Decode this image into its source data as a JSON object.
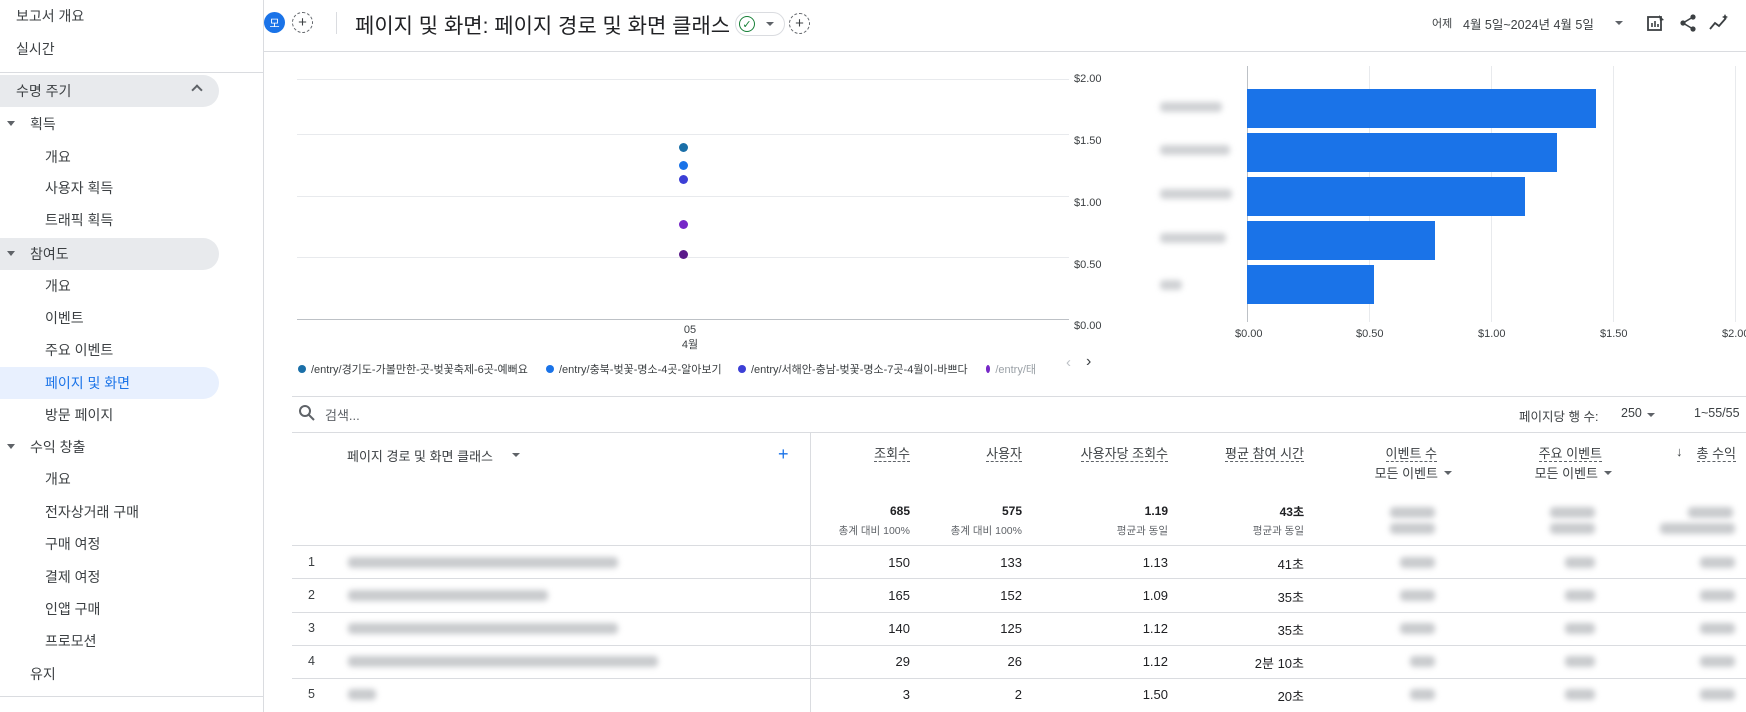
{
  "sidebar": {
    "items": [
      {
        "label": "보고서 개요"
      },
      {
        "label": "실시간"
      },
      {
        "label": "수명 주기"
      },
      {
        "label": "획득"
      },
      {
        "label": "개요"
      },
      {
        "label": "사용자 획득"
      },
      {
        "label": "트래픽 획득"
      },
      {
        "label": "참여도"
      },
      {
        "label": "개요"
      },
      {
        "label": "이벤트"
      },
      {
        "label": "주요 이벤트"
      },
      {
        "label": "페이지 및 화면"
      },
      {
        "label": "방문 페이지"
      },
      {
        "label": "수익 창출"
      },
      {
        "label": "개요"
      },
      {
        "label": "전자상거래 구매"
      },
      {
        "label": "구매 여정"
      },
      {
        "label": "결제 여정"
      },
      {
        "label": "인앱 구매"
      },
      {
        "label": "프로모션"
      },
      {
        "label": "유지"
      }
    ]
  },
  "header": {
    "avatar": "모",
    "add_symbol": "+",
    "title": "페이지 및 화면: 페이지 경로 및 화면 클래스",
    "check_symbol": "✓",
    "date_label": "어제",
    "date_range": "4월 5일~2024년 4월 5일"
  },
  "chart_data": [
    {
      "type": "scatter",
      "x_ticks": [
        "05",
        "4월"
      ],
      "y_ticks": [
        "$2.00",
        "$1.50",
        "$1.00",
        "$0.50",
        "$0.00"
      ],
      "ylim": [
        0,
        2
      ],
      "series": [
        {
          "name": "/entry/경기도-가볼만한-곳-벚꽃축제-6곳-예뻐요",
          "color": "#1a6fa8",
          "values": [
            1.43
          ]
        },
        {
          "name": "/entry/충북-벚꽃-명소-4곳-알아보기",
          "color": "#1a73e8",
          "values": [
            1.28
          ]
        },
        {
          "name": "/entry/서해안-충남-벚꽃-명소-7곳-4월이-바쁘다",
          "color": "#3c3fd6",
          "values": [
            1.16
          ]
        },
        {
          "name": "/entry/태",
          "color": "#7627c7",
          "values": [
            0.79
          ]
        },
        {
          "name": "",
          "color": "#5a1a8a",
          "values": [
            0.54
          ]
        }
      ]
    },
    {
      "type": "bar",
      "orientation": "horizontal",
      "values": [
        1.43,
        1.27,
        1.14,
        0.77,
        0.52
      ],
      "x_ticks": [
        "$0.00",
        "$0.50",
        "$1.00",
        "$1.50",
        "$2.00"
      ],
      "xlim": [
        0,
        2
      ]
    }
  ],
  "legend": {
    "items": [
      {
        "label": "/entry/경기도-가볼만한-곳-벚꽃축제-6곳-예뻐요",
        "color": "#1a6fa8"
      },
      {
        "label": "/entry/충북-벚꽃-명소-4곳-알아보기",
        "color": "#1a73e8"
      },
      {
        "label": "/entry/서해안-충남-벚꽃-명소-7곳-4월이-바쁘다",
        "color": "#3c3fd6"
      },
      {
        "label": "/entry/태",
        "color": "#7627c7"
      }
    ]
  },
  "table": {
    "search_placeholder": "검색...",
    "rows_per_page_label": "페이지당 행 수:",
    "rows_per_page_value": "250",
    "pager": "1~55/55",
    "dimension_header": "페이지 경로 및 화면 클래스",
    "columns": [
      {
        "label": "조회수",
        "total": "685",
        "total_sub": "총계 대비 100%"
      },
      {
        "label": "사용자",
        "total": "575",
        "total_sub": "총계 대비 100%"
      },
      {
        "label": "사용자당 조회수",
        "total": "1.19",
        "total_sub": "평균과 동일"
      },
      {
        "label": "평균 참여 시간",
        "total": "43초",
        "total_sub": "평균과 동일"
      },
      {
        "label": "이벤트 수",
        "sub": "모든 이벤트"
      },
      {
        "label": "주요 이벤트",
        "sub": "모든 이벤트"
      },
      {
        "label": "총 수익"
      }
    ],
    "rows": [
      {
        "n": "1",
        "views": "150",
        "users": "133",
        "vpu": "1.13",
        "time": "41초"
      },
      {
        "n": "2",
        "views": "165",
        "users": "152",
        "vpu": "1.09",
        "time": "35초"
      },
      {
        "n": "3",
        "views": "140",
        "users": "125",
        "vpu": "1.12",
        "time": "35초"
      },
      {
        "n": "4",
        "views": "29",
        "users": "26",
        "vpu": "1.12",
        "time": "2분 10초"
      },
      {
        "n": "5",
        "views": "3",
        "users": "2",
        "vpu": "1.50",
        "time": "20초"
      }
    ]
  }
}
